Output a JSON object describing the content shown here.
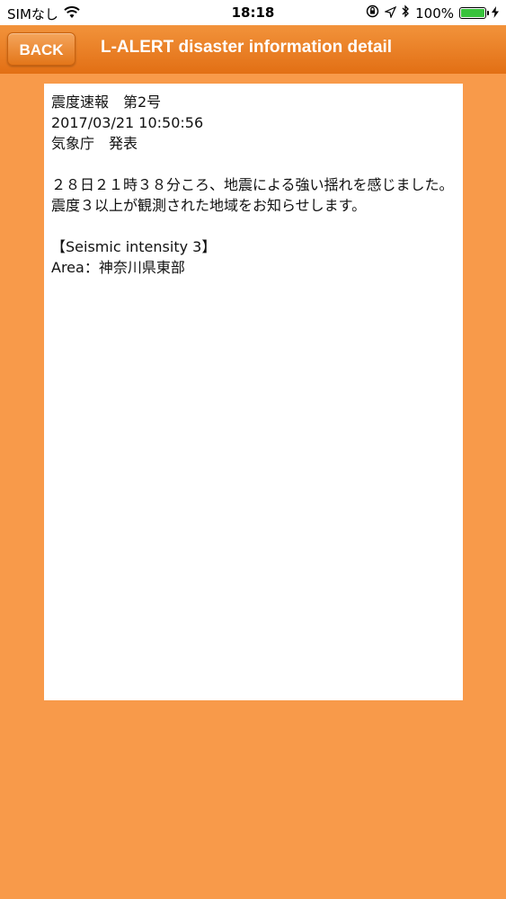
{
  "status_bar": {
    "carrier": "SIMなし",
    "time": "18:18",
    "battery_percent": "100%",
    "battery_level": 1.0,
    "icons": [
      "wifi-icon",
      "rotation-lock-icon",
      "location-arrow-icon",
      "bluetooth-icon",
      "battery-icon",
      "charging-bolt-icon"
    ]
  },
  "nav": {
    "back_label": "BACK",
    "title": "L-ALERT disaster information detail",
    "bar_color": "#e87a1f",
    "background_color": "#f89a4a"
  },
  "detail": {
    "heading": "震度速報　第2号",
    "datetime": "2017/03/21 10:50:56",
    "issuer": "気象庁　発表",
    "body": "２８日２１時３８分ころ、地震による強い揺れを感じました。震度３以上が観測された地域をお知らせします。",
    "intensity_label": "【Seismic intensity 3】",
    "area": "Area：神奈川県東部"
  }
}
